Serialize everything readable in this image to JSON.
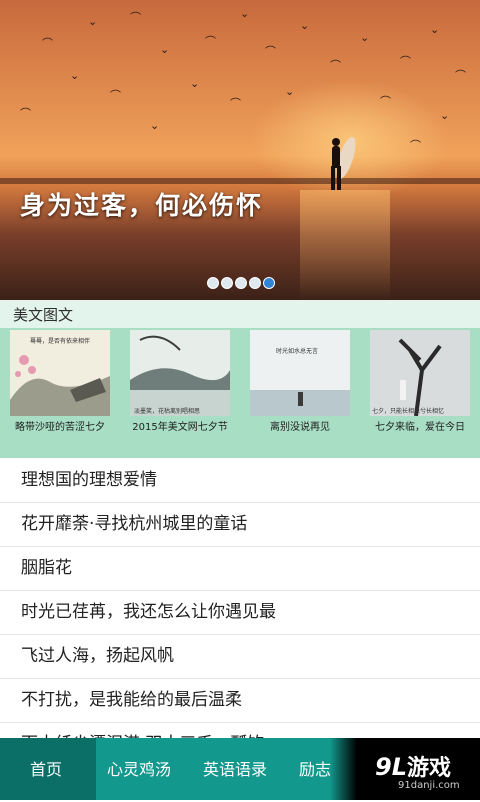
{
  "hero": {
    "caption": "身为过客，何必伤怀",
    "slides": 5,
    "active_slide": 5
  },
  "featured": {
    "title": "美文图文",
    "items": [
      {
        "caption": "略带沙哑的苦涩七夕",
        "image_text": "蓦蓦，是否有依来相伴"
      },
      {
        "caption": "2015年美文网七夕节",
        "image_text": "淡墨笑，花枯离别唱相思"
      },
      {
        "caption": "离别没说再见",
        "image_text": "时光如水总无言"
      },
      {
        "caption": "七夕来临，爱在今日",
        "image_text": "七夕，只能长相思兮长相忆"
      }
    ]
  },
  "articles": [
    "理想国的理想爱情",
    "花开靡荼·寻找杭州城里的童话",
    "胭脂花",
    "时光已荏苒，我还怎么让你遇见最",
    "飞过人海，扬起风帆",
    "不打扰，是我能给的最后温柔",
    "面木纤尘漂泪港 双十三千一瓢饮"
  ],
  "nav": {
    "tabs": [
      "首页",
      "心灵鸡汤",
      "英语语录",
      "励志"
    ],
    "active": "首页"
  },
  "brand": {
    "logo_num": "9L",
    "logo_text": "游戏",
    "url": "91danji.com"
  },
  "colors": {
    "nav_bg": "#12988c",
    "featured_bg": "#a8dfc4",
    "dot_active": "#2f84d6"
  }
}
